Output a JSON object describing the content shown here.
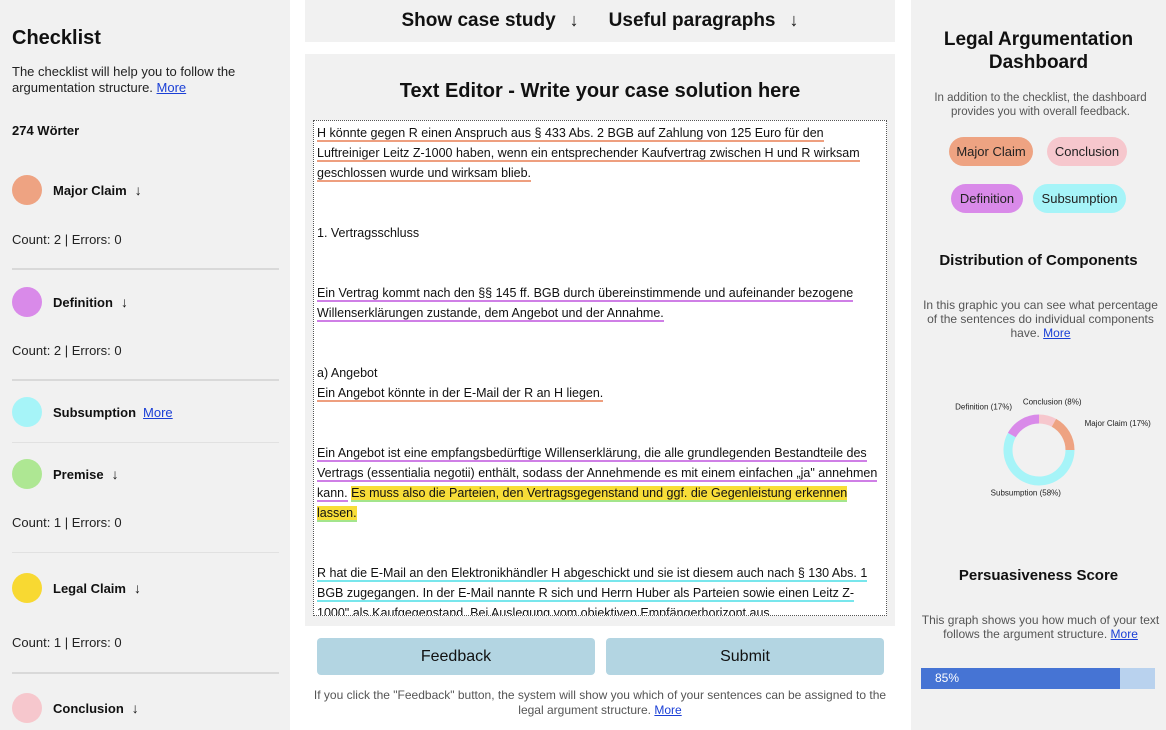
{
  "checklist": {
    "title": "Checklist",
    "intro": "The checklist will help you to follow the argumentation structure.",
    "more": "More",
    "word_count": "274 Wörter",
    "components": [
      {
        "name": "Major Claim",
        "arrow": "↓",
        "count": "Count: 2   |   Errors: 0",
        "color": "#eea382"
      },
      {
        "name": "Definition",
        "arrow": "↓",
        "count": "Count: 2   |   Errors: 0",
        "color": "#d98ae9"
      },
      {
        "name": "Subsumption",
        "more": "More",
        "color": "#a6f4f8"
      },
      {
        "name": "Premise",
        "arrow": "↓",
        "count": "Count: 1   |   Errors: 0",
        "color": "#aee793"
      },
      {
        "name": "Legal Claim",
        "arrow": "↓",
        "count": "Count: 1   |   Errors: 0",
        "color": "#f8d932"
      },
      {
        "name": "Conclusion",
        "arrow": "↓",
        "color": "#f6c7cd"
      }
    ]
  },
  "top_bar": {
    "case_study": "Show case study",
    "paragraphs": "Useful paragraphs",
    "arrow": "↓"
  },
  "editor": {
    "title": "Text Editor - Write your case solution here",
    "p1": "H könnte gegen R einen Anspruch aus § 433 Abs. 2 BGB auf Zahlung von 125 Euro für den Luftreiniger Leitz Z-1000 haben, wenn ein entsprechender Kaufvertrag zwischen H und R wirksam geschlossen wurde und wirksam blieb.",
    "p2": "1. Vertragsschluss",
    "p3": "Ein Vertrag kommt nach den §§ 145 ff. BGB durch übereinstimmende und aufeinander bezogene Willenserklärungen zustande, dem Angebot und der Annahme.",
    "p4a": "a) Angebot",
    "p4b": "Ein Angebot könnte in der E-Mail der R an H liegen.",
    "p5a": "Ein Angebot ist eine empfangsbedürftige Willenserklärung, die alle grundlegenden Bestandteile des Vertrags (essentialia negotii) enthält, sodass der Annehmende es mit einem einfachen „ja\" annehmen kann.",
    "p5b": "Es muss also die Parteien, den Vertragsgegenstand und ggf. die Gegenleistung erkennen lassen.",
    "p6": "R hat die E-Mail an den Elektronikhändler H abgeschickt und sie ist diesem auch nach § 130 Abs. 1 BGB zugegangen. In der E-Mail nannte R sich und Herrn Huber als Parteien sowie einen Leitz Z-1000\" als Kaufgegenstand. Bei Auslegung vom objektiven Empfängerhorizont aus"
  },
  "actions": {
    "feedback": "Feedback",
    "submit": "Submit",
    "note": "If you click the \"Feedback\" button, the system will show you which of your sentences can be assigned to the legal argument structure.",
    "more": "More"
  },
  "dashboard": {
    "title": "Legal Argumentation Dashboard",
    "intro": "In addition to the checklist, the dashboard provides you with overall feedback.",
    "pills": [
      {
        "label": "Major Claim",
        "color": "#eea382"
      },
      {
        "label": "Conclusion",
        "color": "#f6c7cd"
      },
      {
        "label": "Definition",
        "color": "#d98ae9"
      },
      {
        "label": "Subsumption",
        "color": "#a6f4f8"
      }
    ],
    "distribution_title": "Distribution of Components",
    "distribution_text": "In this graphic you can see what percentage of the sentences do individual components have.",
    "more": "More",
    "persuasiveness_title": "Persuasiveness Score",
    "persuasiveness_text": "This graph shows you how much of your text follows the argument structure.",
    "score_label": "85%",
    "score": 0.85
  },
  "chart_data": {
    "type": "pie",
    "categories": [
      "Conclusion",
      "Major Claim",
      "Subsumption",
      "Definition"
    ],
    "values": [
      8,
      17,
      58,
      17
    ],
    "labels": [
      "Conclusion (8%)",
      "Major Claim (17%)",
      "Subsumption (58%)",
      "Definition (17%)"
    ],
    "colors": [
      "#f6c7cd",
      "#eea382",
      "#a6f4f8",
      "#d98ae9"
    ]
  }
}
